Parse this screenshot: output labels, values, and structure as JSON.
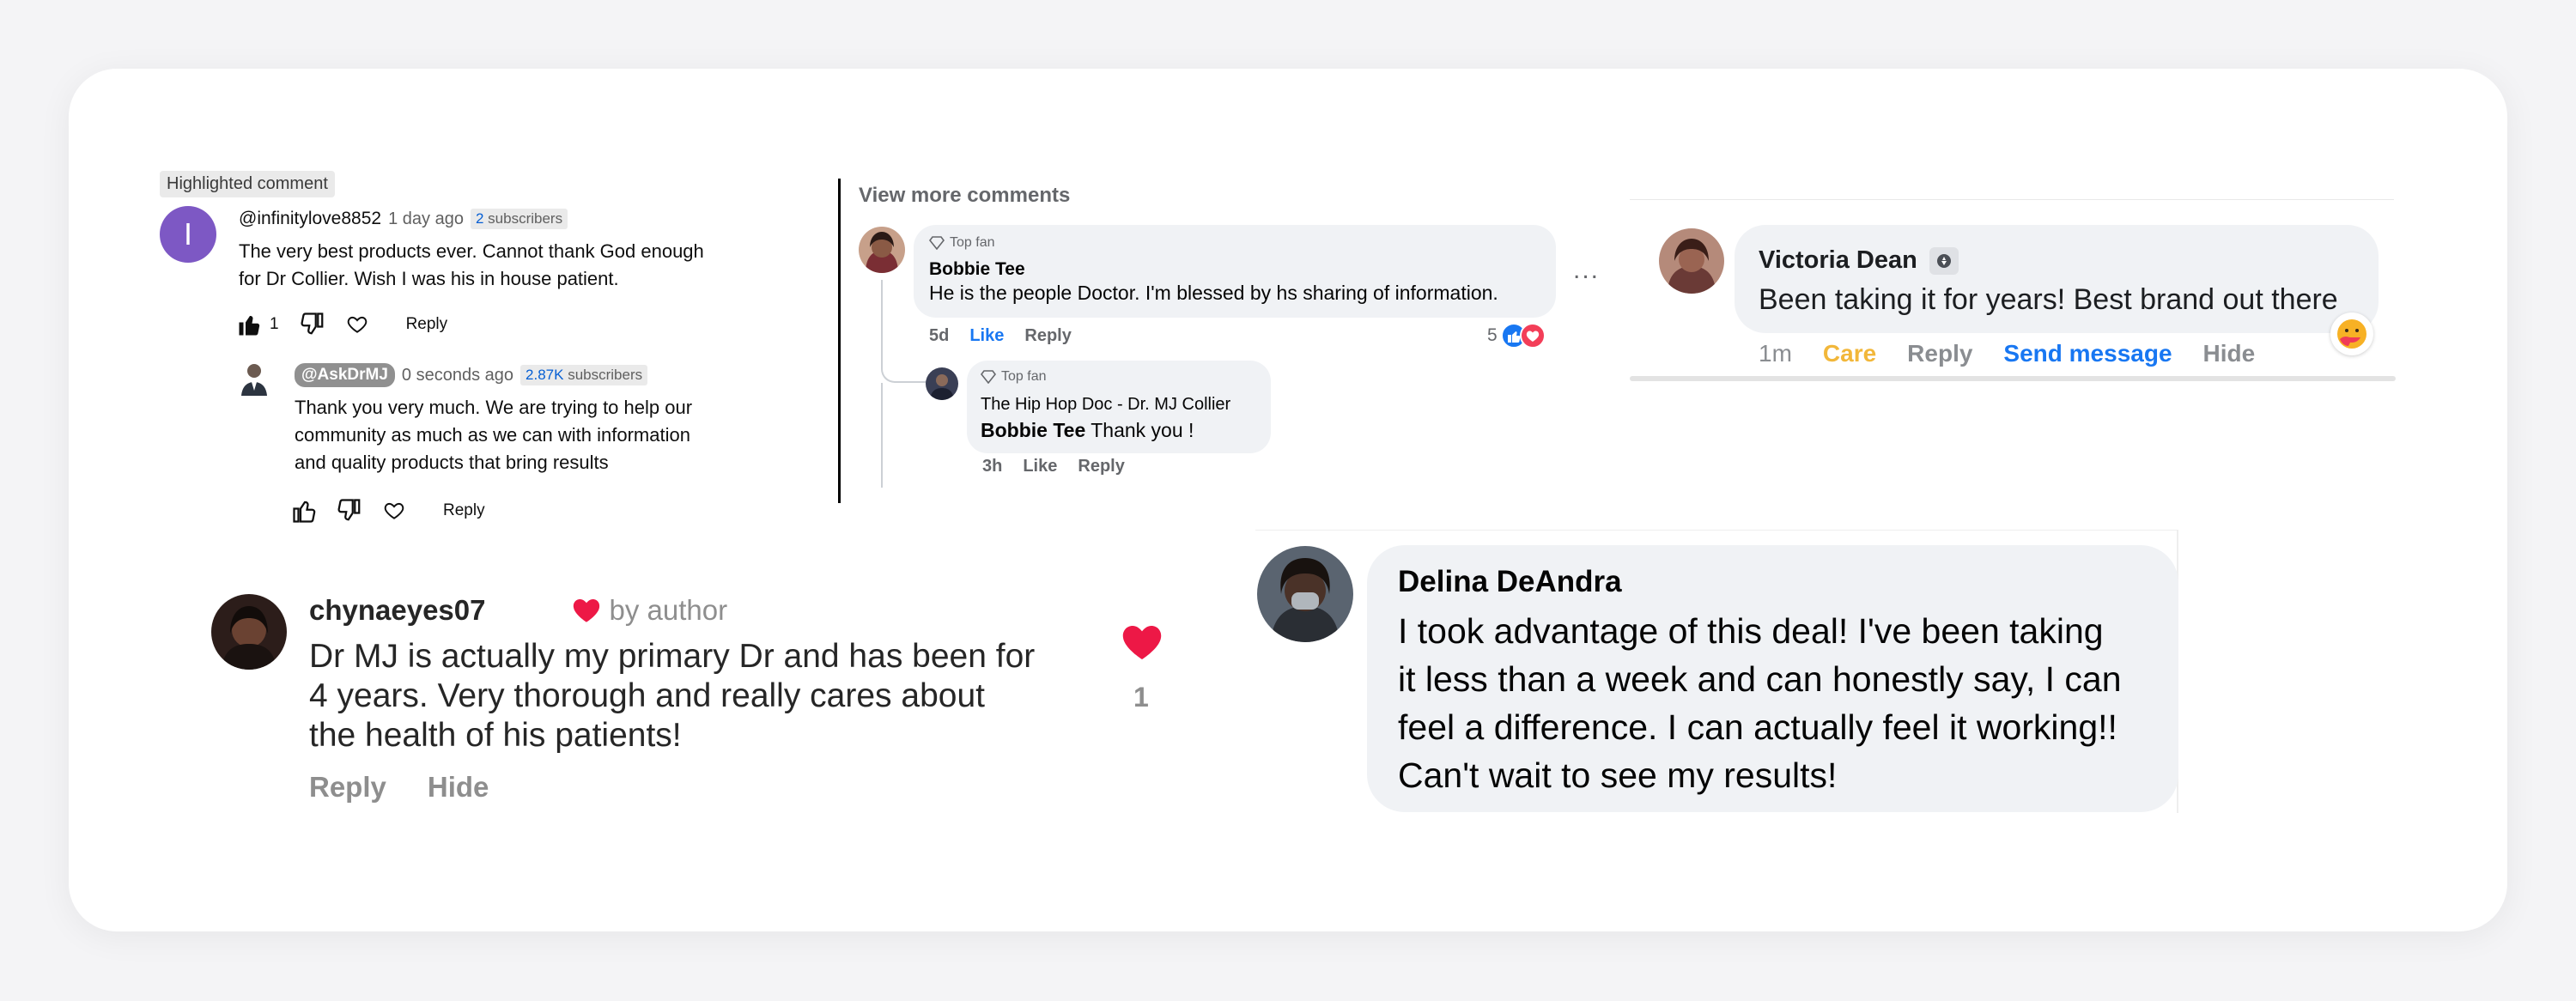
{
  "youtube": {
    "highlighted_label": "Highlighted comment",
    "comment": {
      "avatar_letter": "I",
      "author": "@infinitylove8852",
      "time": "1 day ago",
      "subs_count": "2",
      "subs_suffix": "subscribers",
      "text_line1": "The very best products ever. Cannot thank God enough",
      "text_line2": "for Dr Collier. Wish I was his in house patient.",
      "like_count": "1",
      "reply_label": "Reply"
    },
    "reply": {
      "author": "@AskDrMJ",
      "time": "0 seconds ago",
      "subs_count": "2.87K",
      "subs_suffix": "subscribers",
      "text_line1": "Thank you very much. We are trying to help our",
      "text_line2": "community as much as we can with information",
      "text_line3": "and quality products that bring results",
      "reply_label": "Reply"
    }
  },
  "facebook_thread": {
    "view_more": "View more comments",
    "comment": {
      "badge": "Top fan",
      "author": "Bobbie Tee",
      "text": "He is the people Doctor. I'm blessed by hs sharing of information.",
      "time": "5d",
      "like_label": "Like",
      "reply_label": "Reply",
      "reaction_count": "5",
      "more_label": "..."
    },
    "reply": {
      "badge": "Top fan",
      "author": "The Hip Hop Doc - Dr. MJ Collier",
      "mention": "Bobbie Tee",
      "text": " Thank you !",
      "time": "3h",
      "like_label": "Like",
      "reply_label": "Reply"
    }
  },
  "facebook_victoria": {
    "author": "Victoria Dean",
    "text": "Been taking it for years! Best brand out there",
    "time": "1m",
    "care_label": "Care",
    "reply_label": "Reply",
    "send_label": "Send message",
    "hide_label": "Hide",
    "reaction_icon": "care-emoji-icon"
  },
  "instagram": {
    "username": "chynaeyes07",
    "by_author": "by author",
    "text_line1": "Dr MJ is actually my primary Dr and has been for",
    "text_line2": "4 years.  Very thorough and really cares about",
    "text_line3": "the health of his patients!",
    "reply_label": "Reply",
    "hide_label": "Hide",
    "like_count": "1",
    "heart_color": "#ed1846"
  },
  "facebook_delina": {
    "author": "Delina DeAndra",
    "text_line1": "I took advantage of this deal! I've been taking",
    "text_line2": "it less than a week and can honestly say, I can",
    "text_line3": "feel a difference. I can actually feel it working!!",
    "text_line4": "Can't wait to see my results!"
  }
}
